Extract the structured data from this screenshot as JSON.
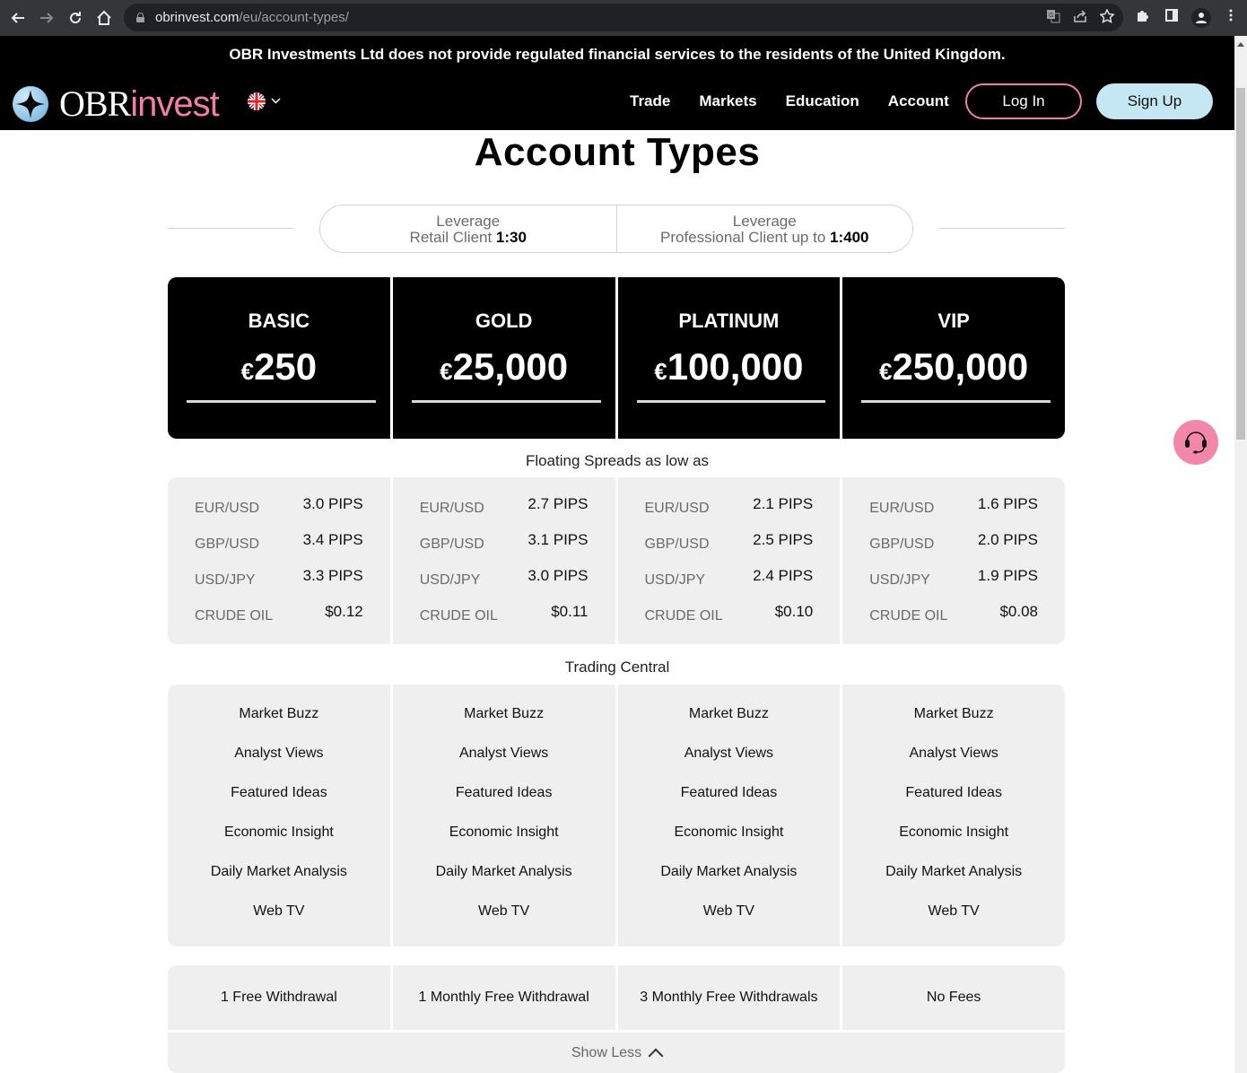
{
  "browser": {
    "url_host": "obrinvest.com",
    "url_path": "/eu/account-types/",
    "nav_icons": [
      "back-icon",
      "forward-icon",
      "reload-icon",
      "home-icon"
    ],
    "omnibox_icons": [
      "translate-icon",
      "share-icon",
      "bookmark-star-icon"
    ],
    "toolbar_icons": [
      "extensions-icon",
      "side-panel-icon",
      "profile-icon",
      "menu-icon"
    ]
  },
  "header": {
    "notice": "OBR Investments Ltd does not provide regulated financial services to the residents of the United Kingdom.",
    "logo_primary": "OBR",
    "logo_secondary": "invest",
    "language": "EN",
    "nav": [
      "Trade",
      "Markets",
      "Education",
      "Account"
    ],
    "login_label": "Log In",
    "signup_label": "Sign Up",
    "colors": {
      "accent_pink": "#f07fa8",
      "signup_bg": "#c5e6f3"
    }
  },
  "page": {
    "title": "Account Types",
    "leverage": [
      {
        "label": "Leverage",
        "text": "Retail Client ",
        "value": "1:30"
      },
      {
        "label": "Leverage",
        "text": "Professional Client up to ",
        "value": "1:400"
      }
    ],
    "plans": [
      {
        "name": "BASIC",
        "currency": "€",
        "amount": "250"
      },
      {
        "name": "GOLD",
        "currency": "€",
        "amount": "25,000"
      },
      {
        "name": "PLATINUM",
        "currency": "€",
        "amount": "100,000"
      },
      {
        "name": "VIP",
        "currency": "€",
        "amount": "250,000"
      }
    ],
    "spreads_label": "Floating Spreads as low as",
    "spreads": [
      [
        {
          "pair": "EUR/USD",
          "value": "3.0 PIPS"
        },
        {
          "pair": "GBP/USD",
          "value": "3.4 PIPS"
        },
        {
          "pair": "USD/JPY",
          "value": "3.3 PIPS"
        },
        {
          "pair": "CRUDE OIL",
          "value": "$0.12"
        }
      ],
      [
        {
          "pair": "EUR/USD",
          "value": "2.7 PIPS"
        },
        {
          "pair": "GBP/USD",
          "value": "3.1 PIPS"
        },
        {
          "pair": "USD/JPY",
          "value": "3.0 PIPS"
        },
        {
          "pair": "CRUDE OIL",
          "value": "$0.11"
        }
      ],
      [
        {
          "pair": "EUR/USD",
          "value": "2.1 PIPS"
        },
        {
          "pair": "GBP/USD",
          "value": "2.5 PIPS"
        },
        {
          "pair": "USD/JPY",
          "value": "2.4 PIPS"
        },
        {
          "pair": "CRUDE OIL",
          "value": "$0.10"
        }
      ],
      [
        {
          "pair": "EUR/USD",
          "value": "1.6 PIPS"
        },
        {
          "pair": "GBP/USD",
          "value": "2.0 PIPS"
        },
        {
          "pair": "USD/JPY",
          "value": "1.9 PIPS"
        },
        {
          "pair": "CRUDE OIL",
          "value": "$0.08"
        }
      ]
    ],
    "trading_central_label": "Trading Central",
    "trading_central_items": [
      "Market Buzz",
      "Analyst Views",
      "Featured Ideas",
      "Economic Insight",
      "Daily Market Analysis",
      "Web TV"
    ],
    "withdrawals": [
      "1 Free Withdrawal",
      "1 Monthly Free Withdrawal",
      "3 Monthly Free Withdrawals",
      "No Fees"
    ],
    "show_less_label": "Show Less"
  },
  "support": {
    "icon": "headset-icon",
    "color": "#f287aa"
  }
}
